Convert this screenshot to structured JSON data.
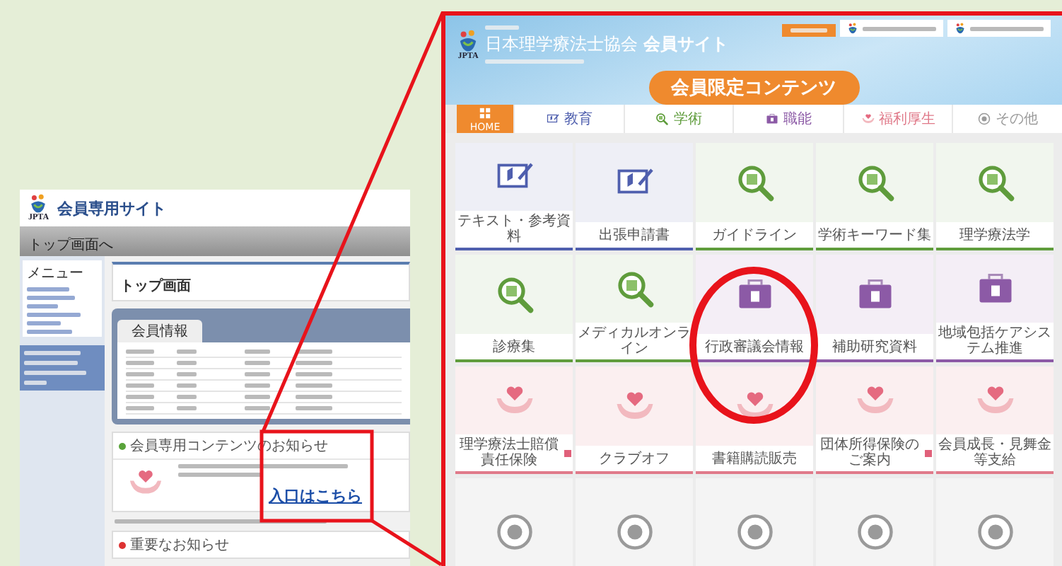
{
  "overview_screenshot": {
    "logo_text": "JPTA",
    "site_title": "会員専用サイト",
    "nav_link": "トップ画面へ",
    "menu_heading": "メニュー",
    "page_heading": "トップ画面",
    "member_info_tab": "会員情報",
    "notice_heading": "会員専用コンテンツのお知らせ",
    "entrance_link": "入口はこちら",
    "important_heading": "重要なお知らせ"
  },
  "detail_screenshot": {
    "logo_text": "JPTA",
    "site_title": "日本理学療法士協会 **会員サイト**",
    "banner": "会員限定コンテンツ",
    "tabs": [
      {
        "label": "HOME",
        "kind": "home",
        "selected": true
      },
      {
        "label": "教育",
        "kind": "education",
        "selected": false
      },
      {
        "label": "学術",
        "kind": "academic",
        "selected": false
      },
      {
        "label": "職能",
        "kind": "work",
        "selected": false
      },
      {
        "label": "福利厚生",
        "kind": "welfare",
        "selected": false
      },
      {
        "label": "その他",
        "kind": "other",
        "selected": false
      }
    ],
    "tiles": [
      {
        "label": "テキスト・参考資料",
        "kind": "education"
      },
      {
        "label": "出張申請書",
        "kind": "education"
      },
      {
        "label": "ガイドライン",
        "kind": "academic"
      },
      {
        "label": "学術キーワード集",
        "kind": "academic"
      },
      {
        "label": "理学療法学",
        "kind": "academic"
      },
      {
        "label": "診療集",
        "kind": "academic"
      },
      {
        "label": "メディカルオンライン",
        "kind": "academic"
      },
      {
        "label": "行政審議会情報",
        "kind": "work"
      },
      {
        "label": "補助研究資料",
        "kind": "work"
      },
      {
        "label": "地域包括ケアシステム推進",
        "kind": "work"
      },
      {
        "label": "理学療法士賠償責任保険",
        "kind": "welfare",
        "external": true
      },
      {
        "label": "クラブオフ",
        "kind": "welfare"
      },
      {
        "label": "書籍購読販売",
        "kind": "welfare"
      },
      {
        "label": "団体所得保険のご案内",
        "kind": "welfare",
        "external": true
      },
      {
        "label": "会員成長・見舞金等支給",
        "kind": "welfare"
      },
      {
        "kind": "other"
      },
      {
        "kind": "other"
      },
      {
        "kind": "other"
      },
      {
        "kind": "other"
      },
      {
        "kind": "other"
      }
    ]
  }
}
